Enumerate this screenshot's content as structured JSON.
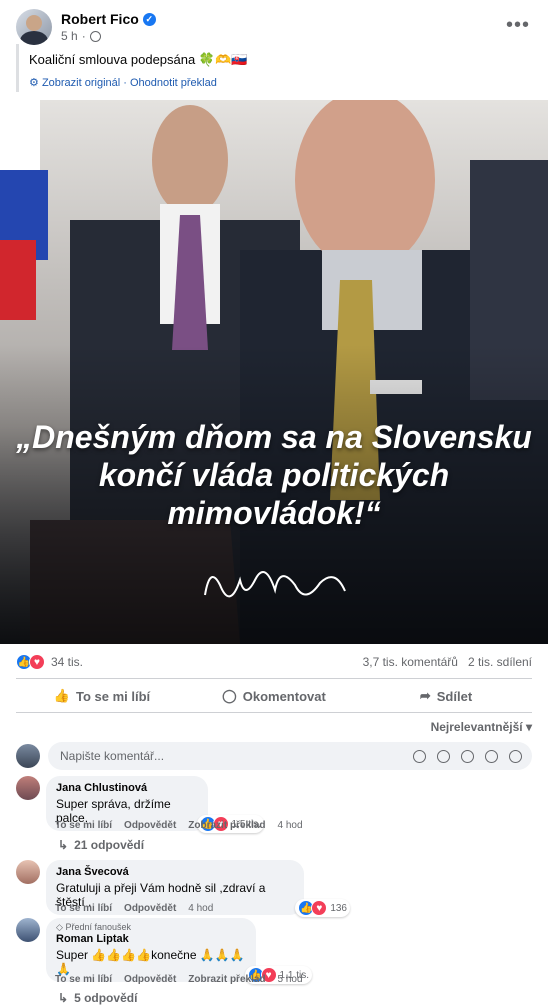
{
  "post": {
    "author": "Robert Fico",
    "time": "5 h",
    "text": "Koaliční smlouva podepsána 🍀🫶🇸🇰",
    "see_original": "Zobrazit originál",
    "rate_translation": "Ohodnotit překlad",
    "separator": "·",
    "image_quote": "„Dnešným dňom sa na Slovensku končí vláda politických mimovládok!“"
  },
  "stats": {
    "reactions": "34 tis.",
    "comments": "3,7 tis. komentářů",
    "shares": "2 tis. sdílení"
  },
  "actions": {
    "like": "To se mi líbí",
    "comment": "Okomentovat",
    "share": "Sdílet"
  },
  "sort_label": "Nejrelevantnější",
  "composer": {
    "placeholder": "Napište komentář..."
  },
  "comments": [
    {
      "name": "Jana Chlustinová",
      "text": "Super správa, držíme palce.",
      "reactions": "1,5 tis.",
      "links": [
        "To se mi líbí",
        "Odpovědět",
        "Zobrazit překlad"
      ],
      "time": "4 hod",
      "replies": "21 odpovědí"
    },
    {
      "name": "Jana Švecová",
      "text": "Gratuluji a přeji Vám hodně sil ,zdraví a štěstí .",
      "reactions": "136",
      "links": [
        "To se mi líbí",
        "Odpovědět"
      ],
      "time": "4 hod"
    },
    {
      "badge": "Přední fanoušek",
      "name": "Roman Liptak",
      "text": "Super 👍👍👍👍konečne 🙏🙏🙏🙏",
      "reactions": "1,1 tis.",
      "links": [
        "To se mi líbí",
        "Odpovědět",
        "Zobrazit překlad"
      ],
      "time": "5 hod",
      "replies": "5 odpovědí"
    }
  ]
}
